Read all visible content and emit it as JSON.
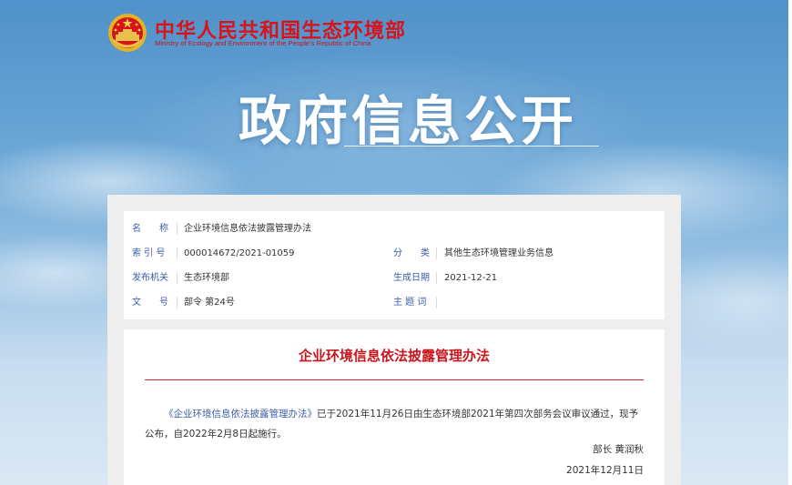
{
  "header": {
    "ministry_cn": "中华人民共和国生态环境部",
    "ministry_en": "Ministry of Ecology and Environment of the People's Republic of China",
    "banner_title": "政府信息公开",
    "emblem_icon": "national-emblem-icon"
  },
  "colors": {
    "brand_red": "#d8141b",
    "label_blue": "#3b5ca8",
    "sky_blue": "#6aa6d6"
  },
  "info": {
    "name_label": "名　　称",
    "name_value": "企业环境信息依法披露管理办法",
    "index_label": "索 引 号",
    "index_value": "000014672/2021-01059",
    "category_label": "分　　类",
    "category_value": "其他生态环境管理业务信息",
    "issuer_label": "发布机关",
    "issuer_value": "生态环境部",
    "date_label": "生成日期",
    "date_value": "2021-12-21",
    "docno_label": "文　　号",
    "docno_value": "部令 第24号",
    "subject_label": "主 题 词",
    "subject_value": ""
  },
  "article": {
    "title": "企业环境信息依法披露管理办法",
    "doc_link": "《企业环境信息依法披露管理办法》",
    "body": "已于2021年11月26日由生态环境部2021年第四次部务会议审议通过，现予公布，自2022年2月8日起施行。",
    "signature": "部长  黄润秋",
    "date": "2021年12月11日"
  }
}
